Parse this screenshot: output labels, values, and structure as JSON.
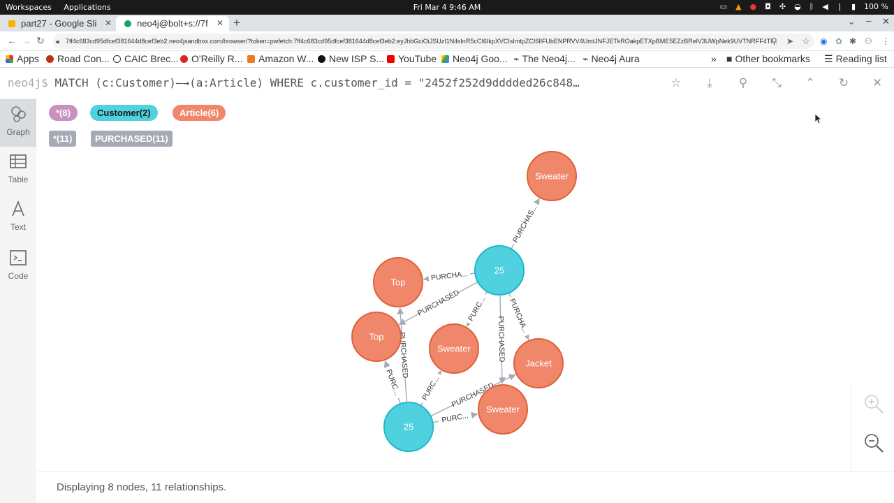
{
  "system": {
    "workspaces": "Workspaces",
    "applications": "Applications",
    "datetime": "Fri Mar 4  9:46 AM",
    "battery": "100 %"
  },
  "browser": {
    "tabs": [
      {
        "title": "part27 - Google Sli",
        "active": false
      },
      {
        "title": "neo4j@bolt+s://7f",
        "active": true
      }
    ],
    "url": "7ff4c683cd95dfcef381644d8cef3eb2.neo4jsandbox.com/browser/?token=pwfetch:7ff4c683cd95dfcef381644d8cef3eb2:eyJhbGciOiJSUzI1NiIsInR5cCI6IkpXVCIsImtpZCI6IlFUbENPRVV4UmtJNFJETkROakpETXpBME5EZzBRelV3UWpNek9UVTNRFF4Tl...",
    "bookmarks": [
      "Apps",
      "Road Con...",
      "CAIC Brec...",
      "O'Reilly R...",
      "Amazon W...",
      "New ISP S...",
      "YouTube",
      "Neo4j Goo...",
      "The Neo4j...",
      "Neo4j Aura"
    ],
    "overflow": "»",
    "other_bookmarks": "Other bookmarks",
    "reading_list": "Reading list"
  },
  "command": {
    "prompt": "neo4j$",
    "query": "MATCH (c:Customer)—→(a:Article) WHERE c.customer_id = \"2452f252d9dddded26c848…"
  },
  "sidebar": [
    {
      "label": "Graph",
      "active": true
    },
    {
      "label": "Table",
      "active": false
    },
    {
      "label": "Text",
      "active": false
    },
    {
      "label": "Code",
      "active": false
    }
  ],
  "legend": {
    "node_labels": [
      {
        "text": "*(8)",
        "color": "#c990c0",
        "fg": "#ffffff"
      },
      {
        "text": "Customer(2)",
        "color": "#4fd1e0",
        "fg": "#1a1a1a"
      },
      {
        "text": "Article(6)",
        "color": "#f0876a",
        "fg": "#ffffff"
      }
    ],
    "rel_types": [
      {
        "text": "*(11)"
      },
      {
        "text": "PURCHASED(11)"
      }
    ]
  },
  "graph": {
    "nodes": [
      {
        "id": "c1",
        "label": "25",
        "kind": "Customer"
      },
      {
        "id": "c2",
        "label": "25",
        "kind": "Customer"
      },
      {
        "id": "a1",
        "label": "Sweater",
        "kind": "Article"
      },
      {
        "id": "a2",
        "label": "Top",
        "kind": "Article"
      },
      {
        "id": "a3",
        "label": "Top",
        "kind": "Article"
      },
      {
        "id": "a4",
        "label": "Sweater",
        "kind": "Article"
      },
      {
        "id": "a5",
        "label": "Jacket",
        "kind": "Article"
      },
      {
        "id": "a6",
        "label": "Sweater",
        "kind": "Article"
      }
    ],
    "relationships": [
      {
        "from": "c1",
        "to": "a1",
        "label": "PURCHAS..."
      },
      {
        "from": "c1",
        "to": "a2",
        "label": "PURCHA..."
      },
      {
        "from": "c1",
        "to": "a3",
        "label": "PURCHASED"
      },
      {
        "from": "c1",
        "to": "a4",
        "label": "PURC..."
      },
      {
        "from": "c1",
        "to": "a5",
        "label": "PURCHA..."
      },
      {
        "from": "c1",
        "to": "a6",
        "label": "PURCHASED"
      },
      {
        "from": "c2",
        "to": "a2",
        "label": "PURCHASED"
      },
      {
        "from": "c2",
        "to": "a3",
        "label": "PURC..."
      },
      {
        "from": "c2",
        "to": "a4",
        "label": "PURC..."
      },
      {
        "from": "c2",
        "to": "a5",
        "label": "PURCHASED"
      },
      {
        "from": "c2",
        "to": "a6",
        "label": "PURC..."
      }
    ],
    "colors": {
      "customer": "#4fd1e0",
      "customer_stroke": "#1fb8ca",
      "article": "#f0876a",
      "article_stroke": "#e0613b",
      "edge": "#a5abb6"
    }
  },
  "status": "Displaying 8 nodes, 11 relationships."
}
